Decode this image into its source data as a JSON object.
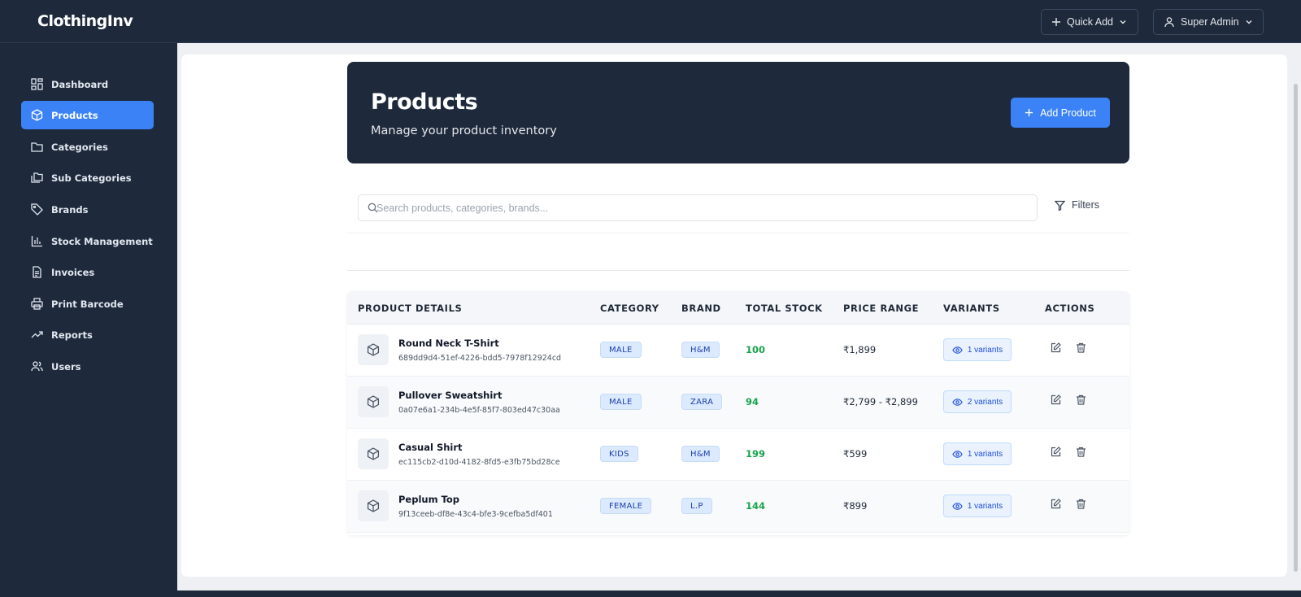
{
  "app": {
    "name": "ClothingInv"
  },
  "topbar": {
    "quick_add": "Quick Add",
    "user": "Super Admin"
  },
  "sidebar": {
    "items": [
      {
        "label": "Dashboard",
        "icon": "dashboard-icon"
      },
      {
        "label": "Products",
        "icon": "box-icon",
        "active": true
      },
      {
        "label": "Categories",
        "icon": "folder-icon"
      },
      {
        "label": "Sub Categories",
        "icon": "folders-icon"
      },
      {
        "label": "Brands",
        "icon": "tag-icon"
      },
      {
        "label": "Stock Management",
        "icon": "bar-chart-icon"
      },
      {
        "label": "Invoices",
        "icon": "file-icon"
      },
      {
        "label": "Print Barcode",
        "icon": "printer-icon"
      },
      {
        "label": "Reports",
        "icon": "trending-up-icon"
      },
      {
        "label": "Users",
        "icon": "users-icon"
      }
    ]
  },
  "header": {
    "title": "Products",
    "subtitle": "Manage your product inventory",
    "add_button": "Add Product"
  },
  "search": {
    "placeholder": "Search products, categories, brands...",
    "value": ""
  },
  "filters_label": "Filters",
  "table": {
    "columns": [
      "PRODUCT DETAILS",
      "CATEGORY",
      "BRAND",
      "TOTAL STOCK",
      "PRICE RANGE",
      "VARIANTS",
      "ACTIONS"
    ],
    "rows": [
      {
        "name": "Round Neck T-Shirt",
        "id": "689dd9d4-51ef-4226-bdd5-7978f12924cd",
        "category": "MALE",
        "brand": "H&M",
        "stock": "100",
        "price": "₹1,899",
        "variants": "1 variants"
      },
      {
        "name": "Pullover Sweatshirt",
        "id": "0a07e6a1-234b-4e5f-85f7-803ed47c30aa",
        "category": "MALE",
        "brand": "ZARA",
        "stock": "94",
        "price": "₹2,799 - ₹2,899",
        "variants": "2 variants"
      },
      {
        "name": "Casual Shirt",
        "id": "ec115cb2-d10d-4182-8fd5-e3fb75bd28ce",
        "category": "KIDS",
        "brand": "H&M",
        "stock": "199",
        "price": "₹599",
        "variants": "1 variants"
      },
      {
        "name": "Peplum Top",
        "id": "9f13ceeb-df8e-43c4-bfe3-9cefba5df401",
        "category": "FEMALE",
        "brand": "L.P",
        "stock": "144",
        "price": "₹899",
        "variants": "1 variants"
      }
    ]
  },
  "colors": {
    "sidebar_bg": "#1e293b",
    "accent": "#3b82f6",
    "stock_green": "#16a34a",
    "chip_bg": "#dbeafe"
  }
}
